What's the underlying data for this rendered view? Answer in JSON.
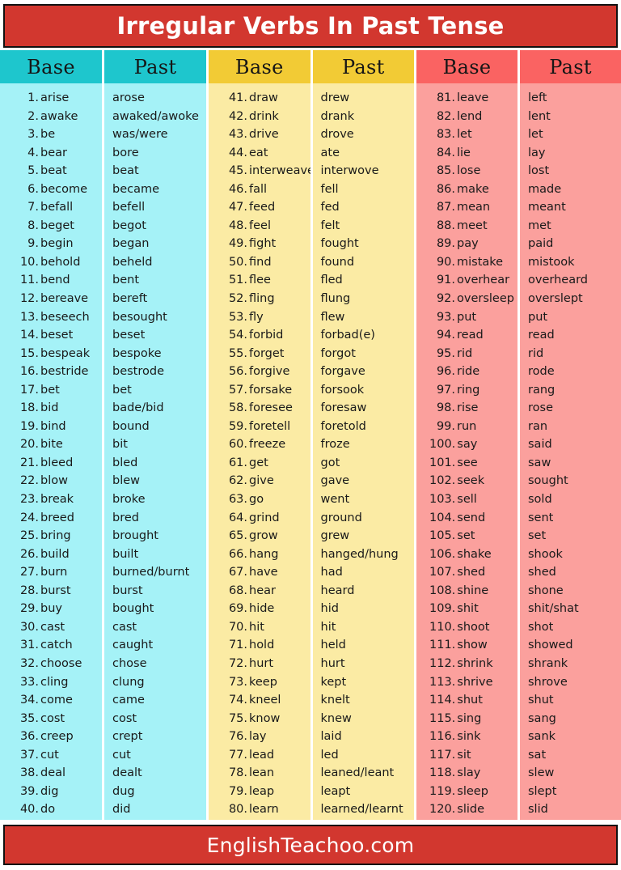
{
  "title": "Irregular Verbs In Past Tense",
  "footer": "EnglishTeachoo.com",
  "watermark": "English Teachoo",
  "colors": {
    "title_bar": "#d2372f",
    "title_text": "#ffffff",
    "teal_header": "#1ec6cd",
    "teal_body": "#a5f2f7",
    "yellow_header": "#f2cb35",
    "yellow_body": "#fbeba4",
    "pink_header": "#fa6362",
    "pink_body": "#fba09d",
    "divider": "#ffffff",
    "text": "#1a1a1a"
  },
  "headers": {
    "base": "Base",
    "past": "Past"
  },
  "sections": [
    {
      "id": "teal",
      "header_base": "Base",
      "header_past": "Past",
      "rows": [
        {
          "num": "1.",
          "base": "arise",
          "past": "arose"
        },
        {
          "num": "2.",
          "base": "awake",
          "past": "awaked/awoke"
        },
        {
          "num": "3.",
          "base": "be",
          "past": "was/were"
        },
        {
          "num": "4.",
          "base": "bear",
          "past": "bore"
        },
        {
          "num": "5.",
          "base": "beat",
          "past": "beat"
        },
        {
          "num": "6.",
          "base": "become",
          "past": "became"
        },
        {
          "num": "7.",
          "base": "befall",
          "past": "befell"
        },
        {
          "num": "8.",
          "base": "beget",
          "past": "begot"
        },
        {
          "num": "9.",
          "base": "begin",
          "past": "began"
        },
        {
          "num": "10.",
          "base": "behold",
          "past": "beheld"
        },
        {
          "num": "11.",
          "base": "bend",
          "past": "bent"
        },
        {
          "num": "12.",
          "base": "bereave",
          "past": "bereft"
        },
        {
          "num": "13.",
          "base": "beseech",
          "past": "besought"
        },
        {
          "num": "14.",
          "base": "beset",
          "past": "beset"
        },
        {
          "num": "15.",
          "base": "bespeak",
          "past": "bespoke"
        },
        {
          "num": "16.",
          "base": "bestride",
          "past": "bestrode"
        },
        {
          "num": "17.",
          "base": "bet",
          "past": "bet"
        },
        {
          "num": "18.",
          "base": "bid",
          "past": "bade/bid"
        },
        {
          "num": "19.",
          "base": "bind",
          "past": "bound"
        },
        {
          "num": "20.",
          "base": "bite",
          "past": "bit"
        },
        {
          "num": "21.",
          "base": "bleed",
          "past": "bled"
        },
        {
          "num": "22.",
          "base": "blow",
          "past": "blew"
        },
        {
          "num": "23.",
          "base": "break",
          "past": "broke"
        },
        {
          "num": "24.",
          "base": "breed",
          "past": "bred"
        },
        {
          "num": "25.",
          "base": "bring",
          "past": "brought"
        },
        {
          "num": "26.",
          "base": "build",
          "past": "built"
        },
        {
          "num": "27.",
          "base": "burn",
          "past": "burned/burnt"
        },
        {
          "num": "28.",
          "base": "burst",
          "past": "burst"
        },
        {
          "num": "29.",
          "base": "buy",
          "past": "bought"
        },
        {
          "num": "30.",
          "base": "cast",
          "past": "cast"
        },
        {
          "num": "31.",
          "base": "catch",
          "past": "caught"
        },
        {
          "num": "32.",
          "base": "choose",
          "past": "chose"
        },
        {
          "num": "33.",
          "base": "cling",
          "past": "clung"
        },
        {
          "num": "34.",
          "base": "come",
          "past": "came"
        },
        {
          "num": "35.",
          "base": "cost",
          "past": "cost"
        },
        {
          "num": "36.",
          "base": "creep",
          "past": "crept"
        },
        {
          "num": "37.",
          "base": "cut",
          "past": "cut"
        },
        {
          "num": "38.",
          "base": "deal",
          "past": "dealt"
        },
        {
          "num": "39.",
          "base": "dig",
          "past": "dug"
        },
        {
          "num": "40.",
          "base": "do",
          "past": "did"
        }
      ]
    },
    {
      "id": "yellow",
      "header_base": "Base",
      "header_past": "Past",
      "rows": [
        {
          "num": "41.",
          "base": "draw",
          "past": "drew"
        },
        {
          "num": "42.",
          "base": "drink",
          "past": "drank"
        },
        {
          "num": "43.",
          "base": "drive",
          "past": "drove"
        },
        {
          "num": "44.",
          "base": "eat",
          "past": "ate"
        },
        {
          "num": "45.",
          "base": "interweave",
          "past": "interwove"
        },
        {
          "num": "46.",
          "base": "fall",
          "past": "fell"
        },
        {
          "num": "47.",
          "base": "feed",
          "past": "fed"
        },
        {
          "num": "48.",
          "base": "feel",
          "past": "felt"
        },
        {
          "num": "49.",
          "base": "fight",
          "past": "fought"
        },
        {
          "num": "50.",
          "base": "find",
          "past": "found"
        },
        {
          "num": "51.",
          "base": "flee",
          "past": "fled"
        },
        {
          "num": "52.",
          "base": "fling",
          "past": "flung"
        },
        {
          "num": "53.",
          "base": "fly",
          "past": "flew"
        },
        {
          "num": "54.",
          "base": "forbid",
          "past": "forbad(e)"
        },
        {
          "num": "55.",
          "base": "forget",
          "past": "forgot"
        },
        {
          "num": "56.",
          "base": "forgive",
          "past": "forgave"
        },
        {
          "num": "57.",
          "base": "forsake",
          "past": "forsook"
        },
        {
          "num": "58.",
          "base": "foresee",
          "past": "foresaw"
        },
        {
          "num": "59.",
          "base": "foretell",
          "past": "foretold"
        },
        {
          "num": "60.",
          "base": "freeze",
          "past": "froze"
        },
        {
          "num": "61.",
          "base": "get",
          "past": "got"
        },
        {
          "num": "62.",
          "base": "give",
          "past": "gave"
        },
        {
          "num": "63.",
          "base": "go",
          "past": "went"
        },
        {
          "num": "64.",
          "base": "grind",
          "past": "ground"
        },
        {
          "num": "65.",
          "base": "grow",
          "past": "grew"
        },
        {
          "num": "66.",
          "base": "hang",
          "past": "hanged/hung"
        },
        {
          "num": "67.",
          "base": "have",
          "past": "had"
        },
        {
          "num": "68.",
          "base": "hear",
          "past": "heard"
        },
        {
          "num": "69.",
          "base": "hide",
          "past": "hid"
        },
        {
          "num": "70.",
          "base": "hit",
          "past": "hit"
        },
        {
          "num": "71.",
          "base": "hold",
          "past": "held"
        },
        {
          "num": "72.",
          "base": "hurt",
          "past": "hurt"
        },
        {
          "num": "73.",
          "base": "keep",
          "past": "kept"
        },
        {
          "num": "74.",
          "base": "kneel",
          "past": "knelt"
        },
        {
          "num": "75.",
          "base": "know",
          "past": "knew"
        },
        {
          "num": "76.",
          "base": "lay",
          "past": "laid"
        },
        {
          "num": "77.",
          "base": "lead",
          "past": "led"
        },
        {
          "num": "78.",
          "base": "lean",
          "past": "leaned/leant"
        },
        {
          "num": "79.",
          "base": "leap",
          "past": "leapt"
        },
        {
          "num": "80.",
          "base": "learn",
          "past": "learned/learnt"
        }
      ]
    },
    {
      "id": "pink",
      "header_base": "Base",
      "header_past": "Past",
      "rows": [
        {
          "num": "81.",
          "base": "leave",
          "past": "left"
        },
        {
          "num": "82.",
          "base": "lend",
          "past": "lent"
        },
        {
          "num": "83.",
          "base": "let",
          "past": "let"
        },
        {
          "num": "84.",
          "base": "lie",
          "past": "lay"
        },
        {
          "num": "85.",
          "base": "lose",
          "past": "lost"
        },
        {
          "num": "86.",
          "base": "make",
          "past": "made"
        },
        {
          "num": "87.",
          "base": "mean",
          "past": "meant"
        },
        {
          "num": "88.",
          "base": "meet",
          "past": "met"
        },
        {
          "num": "89.",
          "base": "pay",
          "past": "paid"
        },
        {
          "num": "90.",
          "base": "mistake",
          "past": "mistook"
        },
        {
          "num": "91.",
          "base": "overhear",
          "past": "overheard"
        },
        {
          "num": "92.",
          "base": "oversleep",
          "past": "overslept"
        },
        {
          "num": "93.",
          "base": "put",
          "past": "put"
        },
        {
          "num": "94.",
          "base": "read",
          "past": "read"
        },
        {
          "num": "95.",
          "base": "rid",
          "past": "rid"
        },
        {
          "num": "96.",
          "base": "ride",
          "past": "rode"
        },
        {
          "num": "97.",
          "base": "ring",
          "past": "rang"
        },
        {
          "num": "98.",
          "base": "rise",
          "past": "rose"
        },
        {
          "num": "99.",
          "base": "run",
          "past": "ran"
        },
        {
          "num": "100.",
          "base": "say",
          "past": "said"
        },
        {
          "num": "101.",
          "base": "see",
          "past": "saw"
        },
        {
          "num": "102.",
          "base": "seek",
          "past": "sought"
        },
        {
          "num": "103.",
          "base": "sell",
          "past": "sold"
        },
        {
          "num": "104.",
          "base": "send",
          "past": "sent"
        },
        {
          "num": "105.",
          "base": "set",
          "past": "set"
        },
        {
          "num": "106.",
          "base": "shake",
          "past": "shook"
        },
        {
          "num": "107.",
          "base": "shed",
          "past": "shed"
        },
        {
          "num": "108.",
          "base": "shine",
          "past": "shone"
        },
        {
          "num": "109.",
          "base": "shit",
          "past": "shit/shat"
        },
        {
          "num": "110.",
          "base": "shoot",
          "past": "shot"
        },
        {
          "num": "111.",
          "base": "show",
          "past": "showed"
        },
        {
          "num": "112.",
          "base": "shrink",
          "past": "shrank"
        },
        {
          "num": "113.",
          "base": "shrive",
          "past": "shrove"
        },
        {
          "num": "114.",
          "base": "shut",
          "past": "shut"
        },
        {
          "num": "115.",
          "base": "sing",
          "past": "sang"
        },
        {
          "num": "116.",
          "base": "sink",
          "past": "sank"
        },
        {
          "num": "117.",
          "base": "sit",
          "past": "sat"
        },
        {
          "num": "118.",
          "base": "slay",
          "past": "slew"
        },
        {
          "num": "119.",
          "base": "sleep",
          "past": "slept"
        },
        {
          "num": "120.",
          "base": "slide",
          "past": "slid"
        }
      ]
    }
  ]
}
